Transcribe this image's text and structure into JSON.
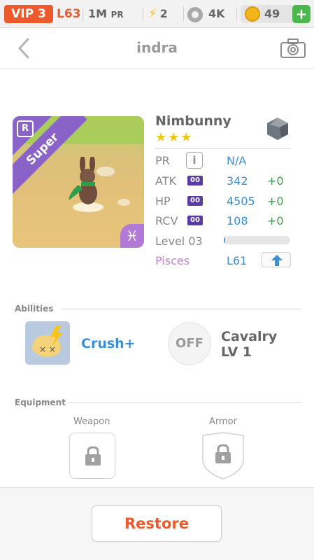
{
  "status": {
    "vip": "VIP 3",
    "level": "L63",
    "pr_value": "1M",
    "pr_unit": "PR",
    "energy": "2",
    "paw": "4K",
    "coins": "49",
    "add": "+"
  },
  "header": {
    "title": "indra"
  },
  "card": {
    "rarity_badge": "R",
    "tier": "Super"
  },
  "pet": {
    "name": "Nimbunny",
    "stars": "★★★",
    "pr_label": "PR",
    "pr_info": "i",
    "pr_value": "N/A",
    "atk_label": "ATK",
    "atk_badge": "00",
    "atk_value": "342",
    "atk_bonus": "+0",
    "hp_label": "HP",
    "hp_badge": "00",
    "hp_value": "4505",
    "hp_bonus": "+0",
    "rcv_label": "RCV",
    "rcv_badge": "00",
    "rcv_value": "108",
    "rcv_bonus": "+0",
    "level_label": "Level 03",
    "level_progress": 0.02,
    "zodiac": "Pisces",
    "zodiac_level": "L61",
    "zodiac_symbol": "♓"
  },
  "abilities": {
    "heading": "Abilities",
    "active_name": "Crush+",
    "passive_state": "OFF",
    "passive_name": "Cavalry",
    "passive_level": "LV 1"
  },
  "equipment": {
    "heading": "Equipment",
    "weapon_label": "Weapon",
    "armor_label": "Armor"
  },
  "footer": {
    "restore_label": "Restore"
  }
}
